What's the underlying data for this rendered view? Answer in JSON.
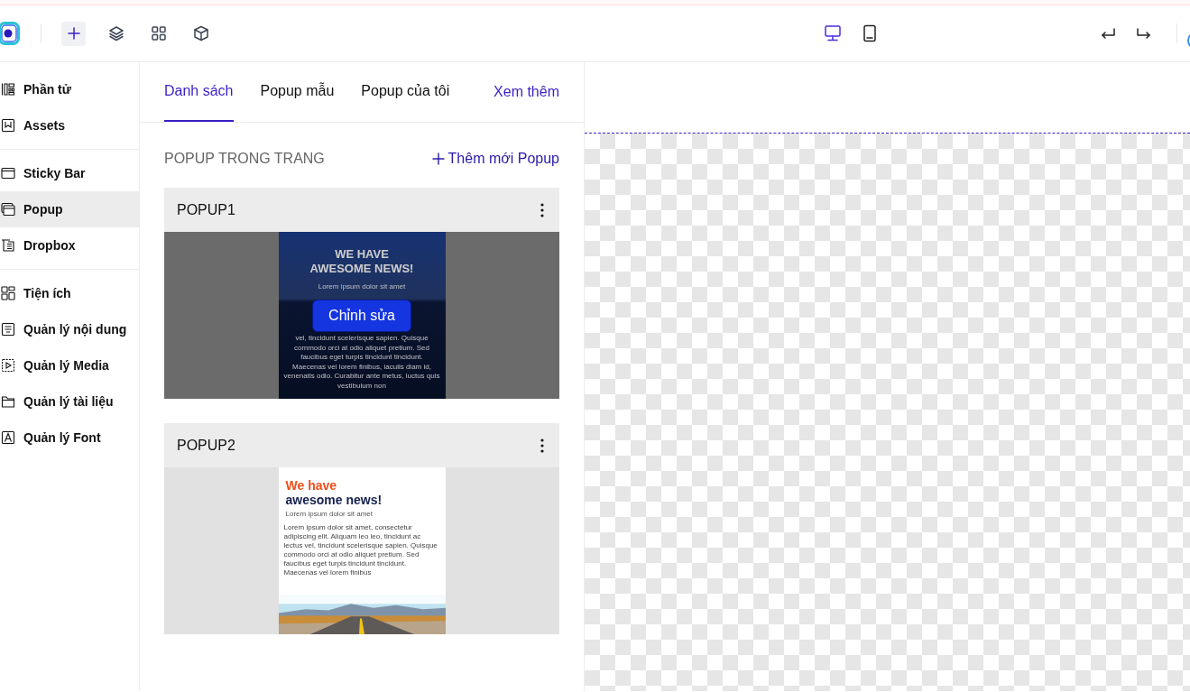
{
  "toolbar": {
    "tools": [
      {
        "kind": "add",
        "selected": true
      },
      {
        "kind": "layers",
        "selected": false
      },
      {
        "kind": "grid",
        "selected": false
      },
      {
        "kind": "box",
        "selected": false
      }
    ],
    "devices": [
      {
        "kind": "desktop",
        "selected": true
      },
      {
        "kind": "mobile",
        "selected": false
      }
    ],
    "history": [
      {
        "kind": "undo"
      },
      {
        "kind": "redo"
      }
    ]
  },
  "sidebar": {
    "groups": [
      [
        {
          "kind": "elements",
          "label": "Phần tử",
          "selected": false
        },
        {
          "kind": "assets",
          "label": "Assets",
          "selected": false
        }
      ],
      [
        {
          "kind": "sticky",
          "label": "Sticky Bar",
          "selected": false
        },
        {
          "kind": "popup",
          "label": "Popup",
          "selected": true
        },
        {
          "kind": "dropbox",
          "label": "Dropbox",
          "selected": false
        }
      ],
      [
        {
          "kind": "widgets",
          "label": "Tiện ích",
          "selected": false
        },
        {
          "kind": "content",
          "label": "Quản lý nội dung",
          "selected": false
        },
        {
          "kind": "media",
          "label": "Quản lý Media",
          "selected": false
        },
        {
          "kind": "folder",
          "label": "Quản lý tài liệu",
          "selected": false
        },
        {
          "kind": "font",
          "label": "Quản lý Font",
          "selected": false
        }
      ]
    ]
  },
  "tabs": [
    {
      "label": "Danh sách",
      "selected": true
    },
    {
      "label": "Popup mẫu",
      "selected": false
    },
    {
      "label": "Popup của tôi",
      "selected": false
    }
  ],
  "more_link": "Xem thêm",
  "section": {
    "title": "POPUP TRONG TRANG",
    "add_link": "Thêm mới Popup"
  },
  "popups": [
    {
      "title": "POPUP1",
      "hovered": true,
      "edit_button": "Chỉnh sửa",
      "preview": {
        "kind": "dark",
        "heading": [
          "WE HAVE",
          "AWESOME NEWS!"
        ],
        "subtitle": "Lorem ipsum dolor sit amet",
        "body": "vel, tincidunt scelerisque sapien. Quisque commodo orci at odio aliquet pretium. Sed faucibus eget turpis tincidunt tincidunt. Maecenas vel lorem finibus, iaculis diam id, venenatis odio. Curabitur ante metus, luctus quis vestibulum non"
      }
    },
    {
      "title": "POPUP2",
      "hovered": false,
      "preview": {
        "kind": "light",
        "heading": [
          "We have",
          "awesome news!"
        ],
        "subtitle": "Lorem ipsum dolor sit amet",
        "body": "Lorem ipsum dolor sit amet, consectetur adipiscing elit. Aliquam leo leo, tincidunt ac lectus vel, tincidunt scelerisque sapien. Quisque commodo orci at odio aliquet pretium. Sed faucibus eget turpis tincidunt tincidunt. Maecenas vel lorem finibus"
      }
    }
  ]
}
